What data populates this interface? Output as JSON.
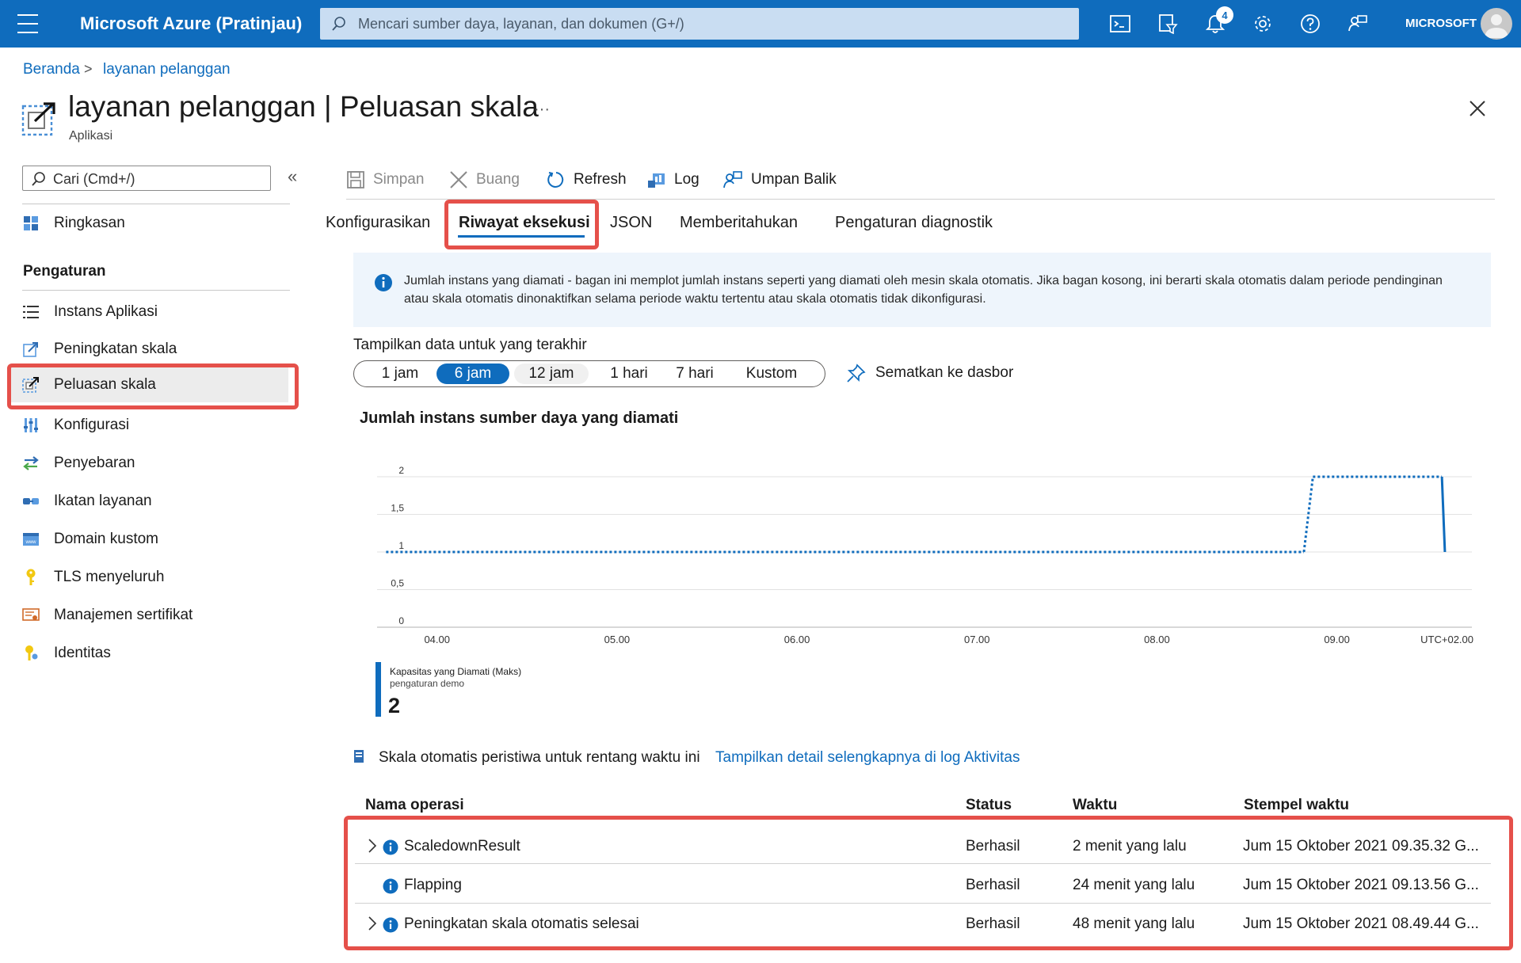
{
  "topbar": {
    "brand": "Microsoft Azure (Pratinjau)",
    "search_placeholder": "Mencari sumber daya, layanan, dan dokumen (G+/)",
    "notification_count": "4",
    "tenant": "MICROSOFT"
  },
  "breadcrumb": {
    "home": "Beranda",
    "sep": ">",
    "current": "layanan pelanggan"
  },
  "page": {
    "title": "layanan pelanggan | Peluasan skala",
    "subtitle": "Aplikasi",
    "more": "···"
  },
  "sidebar": {
    "search_placeholder": "Cari (Cmd+/)",
    "collapse": "«",
    "overview": "Ringkasan",
    "section": "Pengaturan",
    "items": [
      {
        "label": "Instans Aplikasi",
        "icon": "list-icon"
      },
      {
        "label": "Peningkatan skala",
        "icon": "scale-up-icon"
      },
      {
        "label": "Peluasan skala",
        "icon": "scale-out-icon"
      },
      {
        "label": "Konfigurasi",
        "icon": "config-icon"
      },
      {
        "label": "Penyebaran",
        "icon": "deploy-icon"
      },
      {
        "label": "Ikatan layanan",
        "icon": "binding-icon"
      },
      {
        "label": "Domain kustom",
        "icon": "domain-icon"
      },
      {
        "label": "TLS menyeluruh",
        "icon": "key-icon"
      },
      {
        "label": "Manajemen sertifikat",
        "icon": "certificate-icon"
      },
      {
        "label": "Identitas",
        "icon": "identity-icon"
      }
    ]
  },
  "toolbar": {
    "save": "Simpan",
    "discard": "Buang",
    "refresh": "Refresh",
    "log": "Log",
    "feedback": "Umpan Balik"
  },
  "tabs": [
    "Konfigurasikan",
    "Riwayat eksekusi",
    "JSON",
    "Memberitahukan",
    "Pengaturan diagnostik"
  ],
  "info": {
    "text": "Jumlah instans yang diamati - bagan ini memplot jumlah instans seperti yang diamati oleh mesin skala otomatis. Jika bagan kosong, ini berarti skala otomatis dalam periode pendinginan atau skala otomatis dinonaktifkan selama periode waktu tertentu atau skala otomatis tidak dikonfigurasi."
  },
  "range": {
    "label": "Tampilkan data untuk yang terakhir",
    "options": [
      "1 jam",
      "6 jam",
      "12 jam",
      "1 hari",
      "7 hari",
      "Kustom"
    ],
    "selected": "6 jam",
    "pin": "Sematkan ke dasbor"
  },
  "chart_data": {
    "type": "line",
    "title": "Jumlah instans sumber daya yang diamati",
    "x_ticks": [
      "04.00",
      "05.00",
      "06.00",
      "07.00",
      "08.00",
      "09.00"
    ],
    "timezone": "UTC+02.00",
    "y_ticks": [
      "0",
      "0,5",
      "1",
      "1,5",
      "2"
    ],
    "ylim": [
      0,
      2
    ],
    "grid": true,
    "series": [
      {
        "name": "Kapasitas yang Diamati (Maks)",
        "color": "#0f6cbd",
        "points": [
          {
            "x": "03.43",
            "y": 1,
            "style": "dotted"
          },
          {
            "x": "08.49",
            "y": 1,
            "style": "dotted"
          },
          {
            "x": "08.52",
            "y": 2,
            "style": "dotted"
          },
          {
            "x": "09.35",
            "y": 2,
            "style": "solid"
          },
          {
            "x": "09.36",
            "y": 1,
            "style": "solid"
          }
        ]
      }
    ],
    "legend": {
      "name": "Kapasitas yang Diamati (Maks)",
      "sub": "pengaturan demo",
      "value": "2"
    }
  },
  "events": {
    "prefix": "Skala otomatis peristiwa untuk rentang waktu ini",
    "link": "Tampilkan detail selengkapnya di log Aktivitas",
    "headers": {
      "op": "Nama operasi",
      "status": "Status",
      "time": "Waktu",
      "stamp": "Stempel waktu"
    },
    "rows": [
      {
        "op": "ScaledownResult",
        "status": "Berhasil",
        "time": "2 menit yang lalu",
        "stamp": "Jum 15 Oktober 2021 09.35.32 G...",
        "expandable": true
      },
      {
        "op": "Flapping",
        "status": "Berhasil",
        "time": "24 menit yang lalu",
        "stamp": "Jum 15 Oktober 2021 09.13.56 G...",
        "expandable": false
      },
      {
        "op": "Peningkatan skala otomatis selesai",
        "status": "Berhasil",
        "time": "48 menit yang lalu",
        "stamp": "Jum 15 Oktober 2021 08.49.44 G...",
        "expandable": true
      }
    ]
  }
}
